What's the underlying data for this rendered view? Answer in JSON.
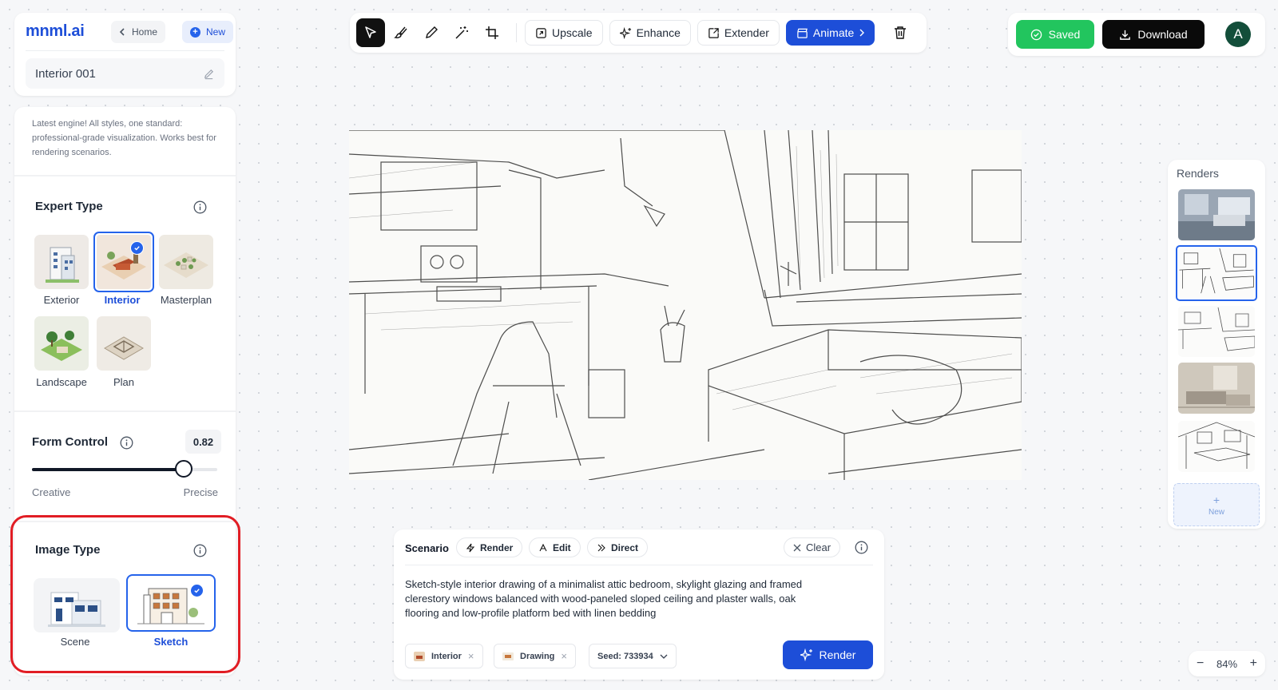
{
  "header": {
    "logo": "mnml.ai",
    "home_label": "Home",
    "new_label": "New",
    "project_name": "Interior 001"
  },
  "sidebar": {
    "description": "Latest engine! All styles, one standard: professional-grade visualization. Works best for rendering scenarios.",
    "expert_type": {
      "title": "Expert Type",
      "options": [
        {
          "label": "Exterior",
          "selected": false
        },
        {
          "label": "Interior",
          "selected": true
        },
        {
          "label": "Masterplan",
          "selected": false
        },
        {
          "label": "Landscape",
          "selected": false
        },
        {
          "label": "Plan",
          "selected": false
        }
      ]
    },
    "form_control": {
      "title": "Form Control",
      "value": "0.82",
      "level": 0.82,
      "min_label": "Creative",
      "max_label": "Precise"
    },
    "image_type": {
      "title": "Image Type",
      "options": [
        {
          "label": "Scene",
          "selected": false
        },
        {
          "label": "Sketch",
          "selected": true
        }
      ]
    }
  },
  "toolbar": {
    "tools": [
      "select-tool-icon",
      "brush-tool-icon",
      "pencil-tool-icon",
      "magic-wand-tool-icon",
      "crop-tool-icon"
    ],
    "upscale_label": "Upscale",
    "enhance_label": "Enhance",
    "extender_label": "Extender",
    "animate_label": "Animate"
  },
  "topright": {
    "saved_label": "Saved",
    "download_label": "Download",
    "avatar_letter": "A"
  },
  "renders": {
    "title": "Renders",
    "new_label": "New",
    "thumbnails": [
      {
        "style": "photo",
        "selected": false
      },
      {
        "style": "sketch",
        "selected": true
      },
      {
        "style": "sketch",
        "selected": false
      },
      {
        "style": "photo-warm",
        "selected": false
      },
      {
        "style": "sketch",
        "selected": false
      }
    ]
  },
  "prompt": {
    "scenario_label": "Scenario",
    "render_chip": "Render",
    "edit_chip": "Edit",
    "direct_chip": "Direct",
    "clear_label": "Clear",
    "text": "Sketch-style interior drawing of a minimalist attic bedroom, skylight glazing and framed clerestory windows balanced with wood-paneled sloped ceiling and plaster walls, oak flooring and low-profile platform bed with linen bedding",
    "tag_interior": "Interior",
    "tag_drawing": "Drawing",
    "seed_label": "Seed: 733934",
    "render_button": "Render"
  },
  "zoom": {
    "level": "84%"
  },
  "colors": {
    "accent": "#1d4ed8",
    "success": "#22c55e",
    "highlight": "#e11d24"
  }
}
